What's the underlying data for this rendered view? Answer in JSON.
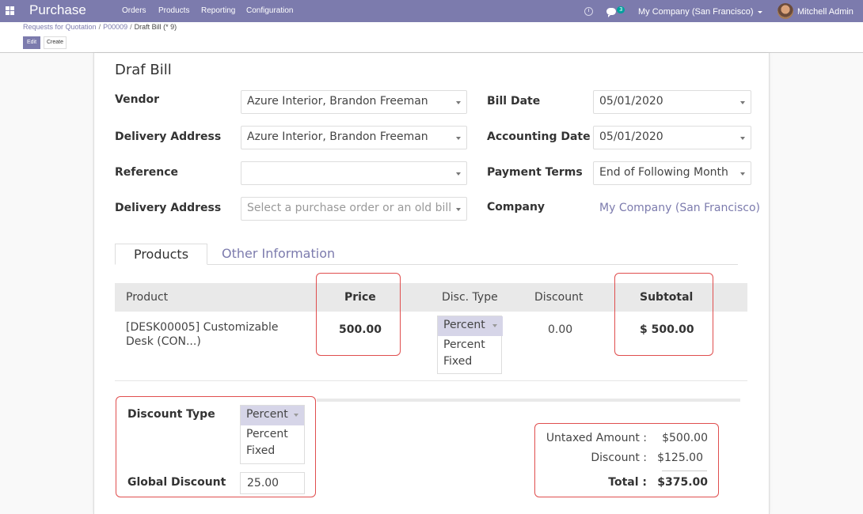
{
  "navbar": {
    "brand": "Purchase",
    "menu": [
      "Orders",
      "Products",
      "Reporting",
      "Configuration"
    ],
    "chat_count": "3",
    "company": "My Company (San Francisco)",
    "user": "Mitchell Admin",
    "color": "#7c7bad"
  },
  "breadcrumb": {
    "items": [
      "Requests for Quotation",
      "P00009",
      "Draft Bill (* 9)"
    ]
  },
  "buttons": {
    "edit": "Edit",
    "create": "Create"
  },
  "form": {
    "title": "Draf Bill",
    "vendor_label": "Vendor",
    "vendor_value": "Azure Interior, Brandon Freeman",
    "delivery_label": "Delivery Address",
    "delivery_value": "Azure Interior, Brandon Freeman",
    "reference_label": "Reference",
    "reference_value": "",
    "delivery2_label": "Delivery Address",
    "delivery2_placeholder": "Select a purchase order or an old bill",
    "bill_date_label": "Bill Date",
    "bill_date_value": "05/01/2020",
    "accounting_date_label": "Accounting Date",
    "accounting_date_value": "05/01/2020",
    "payment_terms_label": "Payment Terms",
    "payment_terms_value": "End of Following Month",
    "company_label": "Company",
    "company_value": "My Company (San Francisco)"
  },
  "tabs": [
    "Products",
    "Other Information"
  ],
  "table": {
    "headers": {
      "product": "Product",
      "price": "Price",
      "disc_type": "Disc. Type",
      "discount": "Discount",
      "subtotal": "Subtotal"
    },
    "row": {
      "product_line1": "[DESK00005] Customizable",
      "product_line2": "Desk (CON...)",
      "price": "500.00",
      "disc_type_selected": "Percent",
      "disc_type_options": [
        "Percent",
        "Fixed"
      ],
      "discount": "0.00",
      "subtotal": "$ 500.00"
    }
  },
  "global_discount": {
    "type_label": "Discount Type",
    "type_selected": "Percent",
    "type_options": [
      "Percent",
      "Fixed"
    ],
    "amount_label": "Global Discount",
    "amount_value": "25.00"
  },
  "totals": {
    "untaxed_label": "Untaxed Amount :",
    "untaxed_value": "$500.00",
    "discount_label": "Discount :",
    "discount_value": "$125.00",
    "total_label": "Total :",
    "total_value": "$375.00"
  }
}
